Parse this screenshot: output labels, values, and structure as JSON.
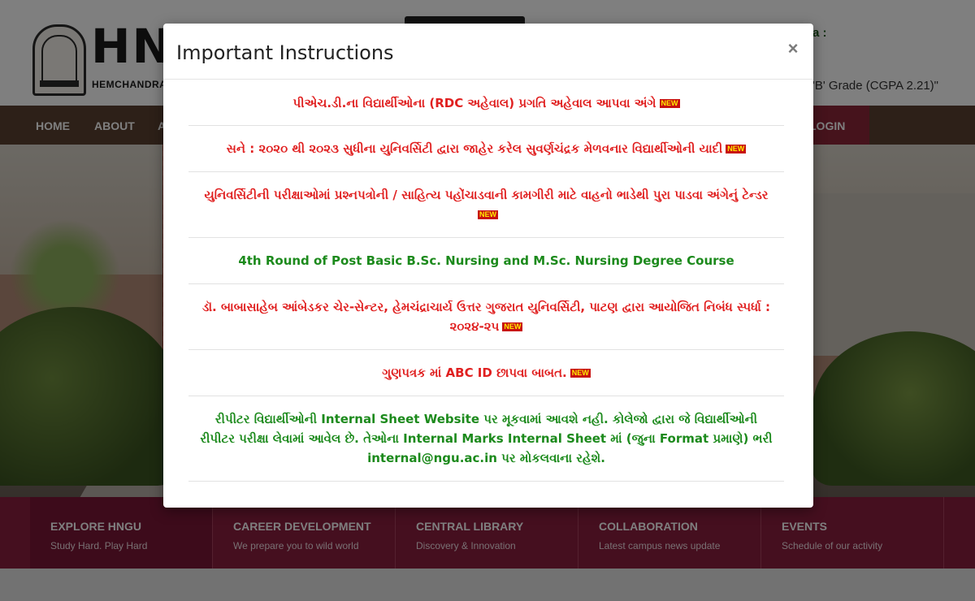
{
  "header": {
    "logo_text": "HNG",
    "logo_subtitle": "HEMCHANDRAC",
    "side_label": "a :",
    "grade_text": "'B' Grade (CGPA 2.21)\""
  },
  "nav": {
    "home": "HOME",
    "about": "ABOUT",
    "partial": "A",
    "login": "LOGIN"
  },
  "footer": {
    "columns": [
      {
        "title": "EXPLORE HNGU",
        "desc": "Study Hard. Play Hard"
      },
      {
        "title": "CAREER DEVELOPMENT",
        "desc": "We prepare you to wild world"
      },
      {
        "title": "CENTRAL LIBRARY",
        "desc": "Discovery & Innovation"
      },
      {
        "title": "COLLABORATION",
        "desc": "Latest campus news update"
      },
      {
        "title": "EVENTS",
        "desc": "Schedule of our activity"
      }
    ]
  },
  "modal": {
    "title": "Important Instructions",
    "close_symbol": "×",
    "new_badge": "NEW",
    "notices": [
      {
        "text": "પીએચ.ડી.ના વિદ્યાર્થીઓના (RDC અહેવાલ) પ્રગતિ અહેવાલ આપવા અંગે",
        "color": "#e02020",
        "is_new": true
      },
      {
        "text": "સને : ૨૦૨૦ થી ૨૦૨૩ સુધીના યુનિવર્સિટી દ્વારા જાહેર કરેલ સુવર્ણચંદ્રક મેળવનાર વિદ્યાર્થીઓની યાદી",
        "color": "#e02020",
        "is_new": true
      },
      {
        "text": "યુનિવર્સિટીની પરીક્ષાઓમાં પ્રશ્નપત્રોની / સાહિત્ય પહોંચાડવાની કામગીરી માટે વાહનો ભાડેથી પુરા પાડવા અંગેનું ટેન્ડર",
        "color": "#e02020",
        "is_new": true
      },
      {
        "text": "4th Round of Post Basic B.Sc. Nursing and M.Sc. Nursing Degree Course",
        "color": "#1c8a1c",
        "is_new": false
      },
      {
        "text": "ડૉ. બાબાસાહેબ આંબેડકર ચેર-સેન્ટર, હેમચંદ્રાચાર્ય ઉત્તર ગુજરાત યુનિવર્સિટી, પાટણ દ્વારા આયોજિત નિબંધ સ્પર્ધા : ૨૦૨૪-૨૫",
        "color": "#e02020",
        "is_new": true
      },
      {
        "text": "ગુણપત્રક માં ABC ID છાપવા બાબત.",
        "color": "#e02020",
        "is_new": true
      },
      {
        "text": "રીપીટર વિદ્યાર્થીઓની Internal Sheet Website પર મૂકવામાં આવશે નહી. કોલેજો દ્વારા જે વિદ્યાર્થીઓની રીપીટર પરીક્ષા લેવામાં આવેલ છે. તેઓના Internal Marks Internal Sheet માં (જુના Format પ્રમાણે) ભરી internal@ngu.ac.in પર મોકલવાના રહેશે.",
        "color": "#1c8a1c",
        "is_new": false
      }
    ]
  }
}
